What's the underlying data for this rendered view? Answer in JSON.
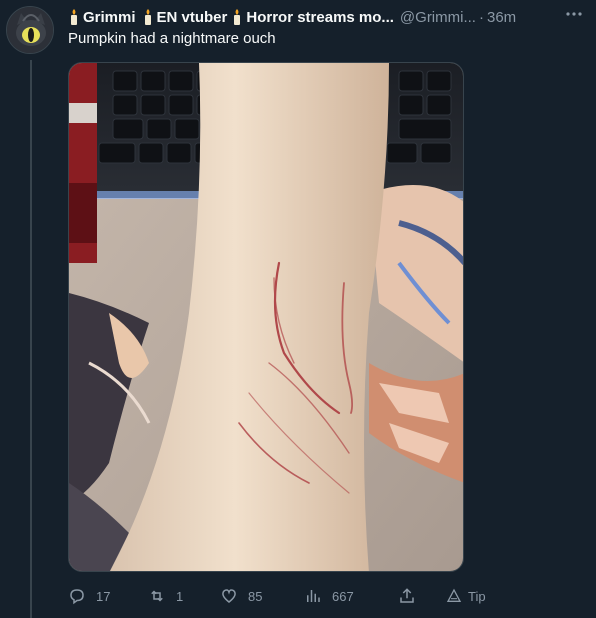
{
  "author": {
    "display_name_parts": [
      "Grimmi",
      "EN vtuber",
      "Horror streams mo..."
    ],
    "handle": "@Grimmi...",
    "separator": "·",
    "time": "36m"
  },
  "tweet": {
    "text": "Pumpkin had a nightmare ouch"
  },
  "actions": {
    "reply_count": "17",
    "retweet_count": "1",
    "like_count": "85",
    "views_count": "667",
    "tip_label": "Tip"
  },
  "colors": {
    "background": "#15202b",
    "secondary_text": "#8b98a5",
    "border": "#38444d"
  },
  "icons": [
    "candle-emoji-icon",
    "more-options-icon",
    "reply-icon",
    "retweet-icon",
    "like-icon",
    "views-icon",
    "share-icon",
    "tip-icon"
  ]
}
